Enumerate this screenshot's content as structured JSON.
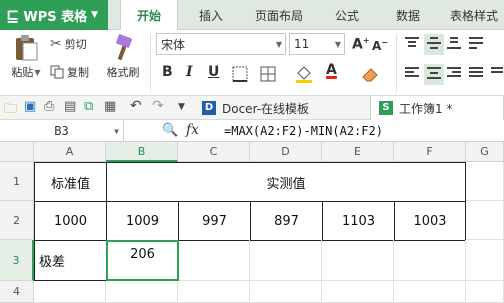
{
  "app": {
    "name": "WPS 表格"
  },
  "tabs": [
    "开始",
    "插入",
    "页面布局",
    "公式",
    "数据",
    "表格样式"
  ],
  "ribbon": {
    "clipboard": {
      "paste": "粘贴",
      "cut": "剪切",
      "copy": "复制",
      "format_painter": "格式刷"
    },
    "font": {
      "name": "宋体",
      "size": "11",
      "grow": "A",
      "shrink": "A",
      "bold": "B",
      "italic": "I",
      "underline": "U",
      "font_color": "A"
    }
  },
  "qat": {
    "doc_tabs": [
      {
        "label": "Docer-在线模板"
      },
      {
        "label": "工作簿1 *"
      }
    ]
  },
  "formula_bar": {
    "name_box": "B3",
    "fx": "fx",
    "formula": "=MAX(A2:F2)-MIN(A2:F2)"
  },
  "sheet": {
    "columns": [
      "A",
      "B",
      "C",
      "D",
      "E",
      "F",
      "G"
    ],
    "rows": [
      "1",
      "2",
      "3",
      "4"
    ],
    "selected_cell": "B3",
    "cells": {
      "A1": "标准值",
      "B1": "实测值",
      "A2": "1000",
      "B2": "1009",
      "C2": "997",
      "D2": "897",
      "E2": "1103",
      "F2": "1003",
      "A3": "极差",
      "B3": "206"
    }
  },
  "colors": {
    "accent": "#2f9f58",
    "tabbar": "#dfe9e1"
  }
}
